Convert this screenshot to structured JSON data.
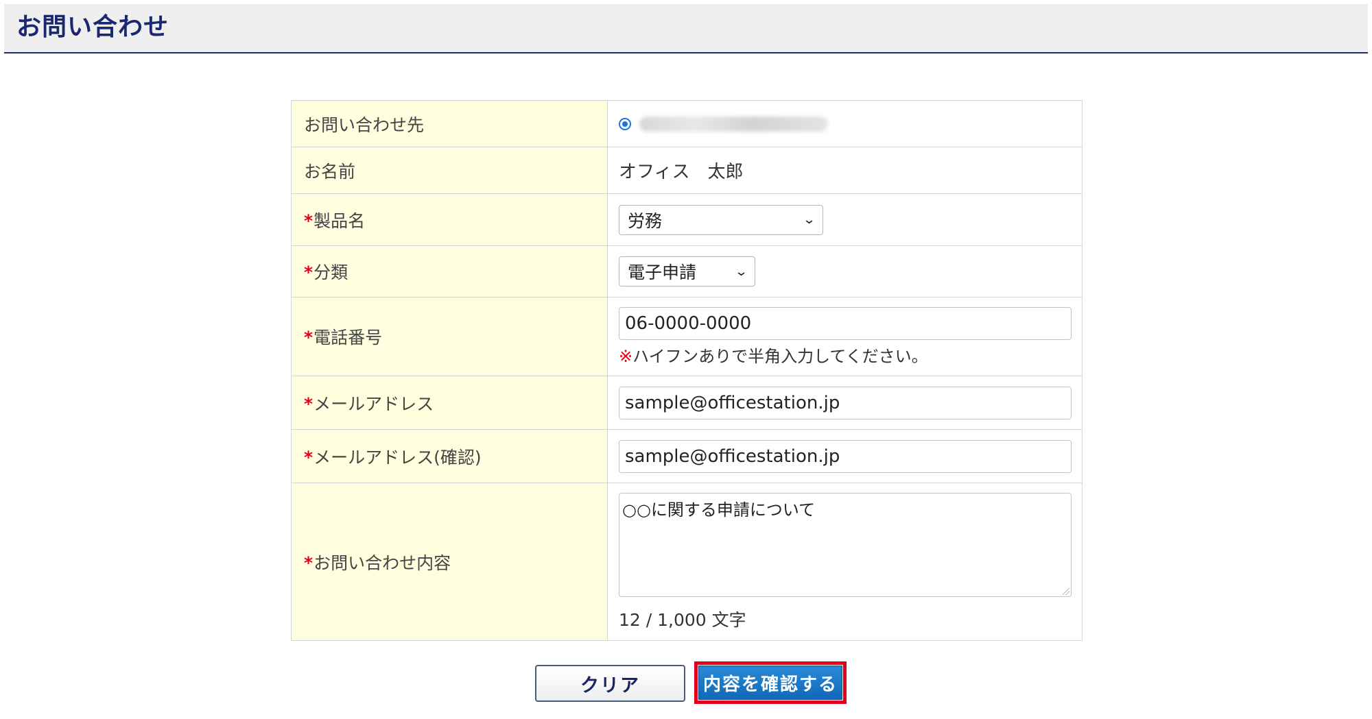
{
  "header": {
    "title": "お問い合わせ"
  },
  "form": {
    "destination": {
      "label": "お問い合わせ先"
    },
    "name": {
      "label": "お名前",
      "value": "オフィス　太郎"
    },
    "product": {
      "required_mark": "*",
      "label": "製品名",
      "selected": "労務"
    },
    "category": {
      "required_mark": "*",
      "label": "分類",
      "selected": "電子申請"
    },
    "phone": {
      "required_mark": "*",
      "label": "電話番号",
      "value": "06-0000-0000",
      "note_mark": "※",
      "note": "ハイフンありで半角入力してください。"
    },
    "email": {
      "required_mark": "*",
      "label": "メールアドレス",
      "value": "sample@officestation.jp"
    },
    "email_confirm": {
      "required_mark": "*",
      "label": "メールアドレス(確認)",
      "value": "sample@officestation.jp"
    },
    "content": {
      "required_mark": "*",
      "label": "お問い合わせ内容",
      "value": "○○に関する申請について",
      "counter": "12 / 1,000 文字"
    }
  },
  "buttons": {
    "clear_label": "クリア",
    "confirm_label": "内容を確認する"
  },
  "colors": {
    "header_title": "#1a2870",
    "label_background": "#ffffe0",
    "required": "#e0001a",
    "confirm_button": "#1a78c8",
    "highlight_outline": "#e3001b"
  },
  "icons": {
    "select_arrow": "chevron-down-icon",
    "radio": "radio-selected-icon"
  }
}
